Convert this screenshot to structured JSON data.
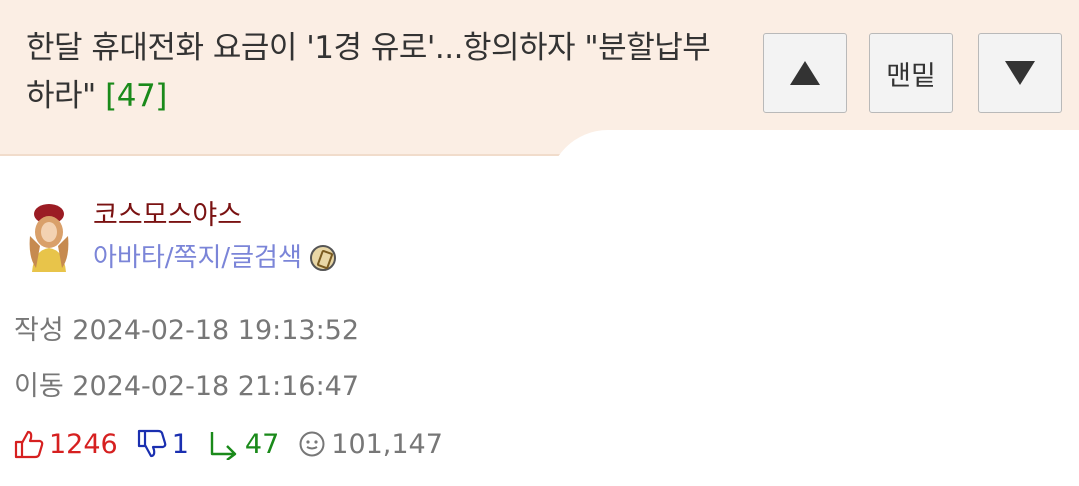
{
  "header": {
    "title": "한달 휴대전화 요금이 '1경 유로'...항의하자 \"분할납부하라\"",
    "comment_count": "[47]",
    "up_label": "▲",
    "bottom_label": "맨밑",
    "down_label": "▼"
  },
  "author": {
    "nickname": "코스모스야스",
    "links": [
      "아바타",
      "쪽지",
      "글검색"
    ],
    "separator": "/"
  },
  "meta": {
    "created_label": "작성",
    "created_value": "2024-02-18 19:13:52",
    "moved_label": "이동",
    "moved_value": "2024-02-18 21:16:47"
  },
  "stats": {
    "likes": "1246",
    "dislikes": "1",
    "comments": "47",
    "views": "101,147"
  },
  "colors": {
    "header_bg": "#fbeee4",
    "like": "#d62020",
    "dislike": "#1a2fb0",
    "comment": "#1a8a1a",
    "nickname": "#7a1212",
    "link": "#7b85d8"
  },
  "icons": {
    "like": "thumbs-up-icon",
    "dislike": "thumbs-down-icon",
    "comment": "reply-arrow-icon",
    "views": "smiley-icon",
    "level": "level-badge-icon"
  }
}
